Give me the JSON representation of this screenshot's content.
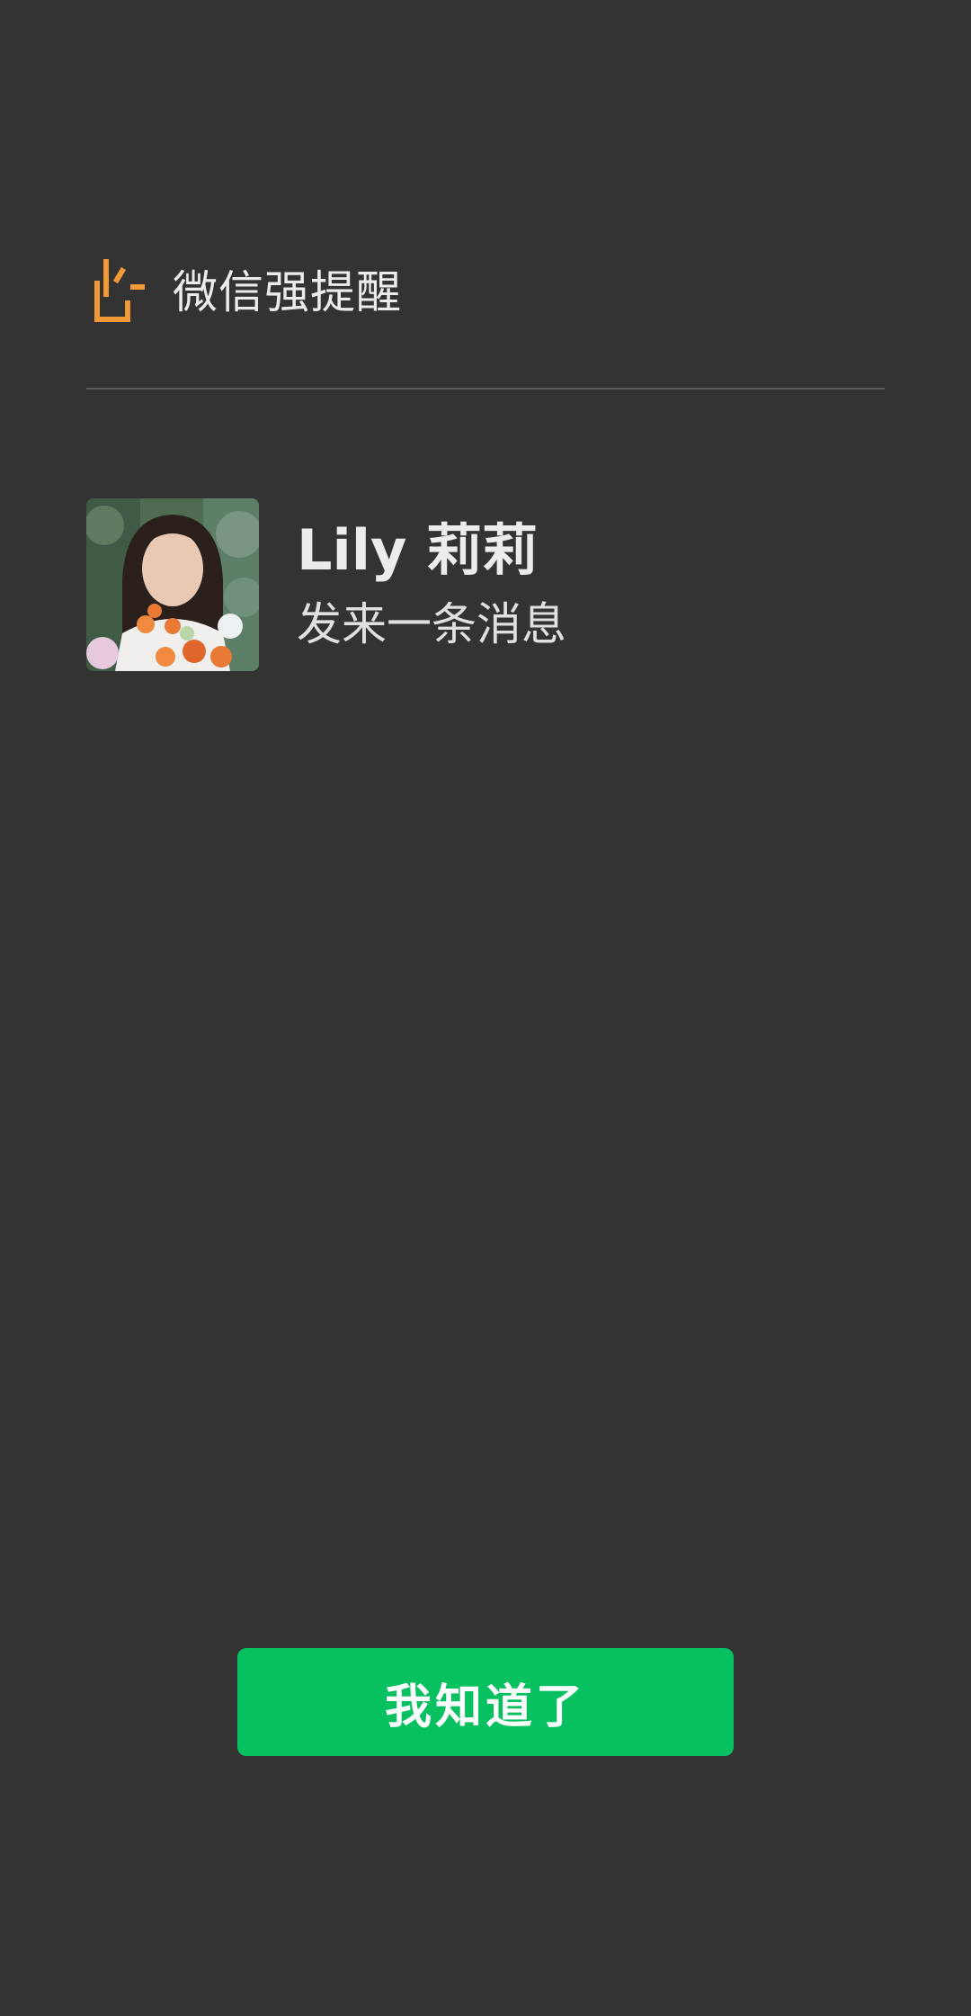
{
  "header": {
    "icon": "alert-bell-icon",
    "title": "微信强提醒",
    "accent_color": "#f29a38"
  },
  "sender": {
    "avatar": "contact-avatar-photo",
    "name": "Lily 莉莉",
    "subtitle": "发来一条消息"
  },
  "actions": {
    "ack_label": "我知道了",
    "button_color": "#07c160"
  },
  "theme": {
    "background": "#333333",
    "text": "#ececec",
    "divider": "#5b5b5b"
  }
}
